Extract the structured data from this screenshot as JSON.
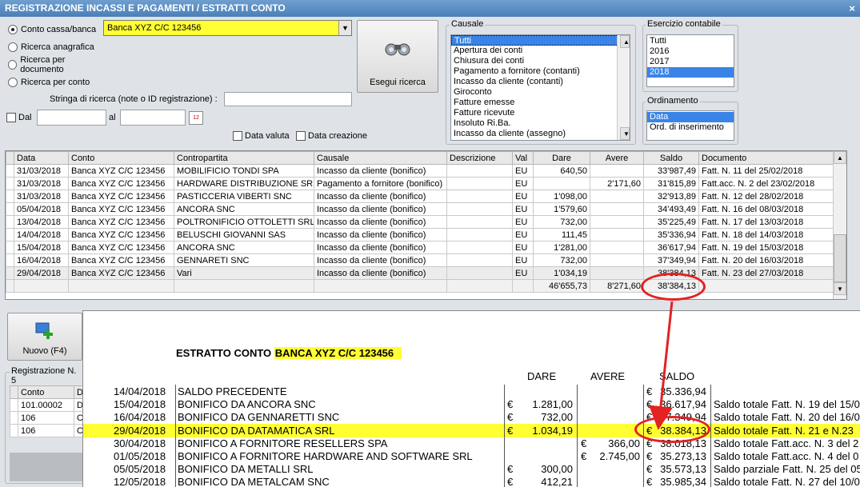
{
  "window": {
    "title": "REGISTRAZIONE INCASSI E PAGAMENTI / ESTRATTI CONTO",
    "close_glyph": "×"
  },
  "search": {
    "radios": [
      {
        "label": "Conto cassa/banca",
        "selected": true
      },
      {
        "label": "Ricerca anagrafica",
        "selected": false
      },
      {
        "label": "Ricerca per documento",
        "selected": false
      },
      {
        "label": "Ricerca per conto",
        "selected": false
      }
    ],
    "account_value": "Banca XYZ C/C 123456",
    "search_string_label": "Stringa di ricerca (note o ID registrazione) :",
    "search_string_value": "",
    "dal_label": "Dal",
    "al_label": "al",
    "dal_value": "",
    "al_value": "",
    "data_valuta_label": "Data valuta",
    "data_creazione_label": "Data creazione",
    "run_button": "Esegui ricerca",
    "calendar_icon_text": "12"
  },
  "causale": {
    "title": "Causale",
    "items": [
      "Tutti",
      "Apertura dei conti",
      "Chiusura dei conti",
      "Pagamento a fornitore (contanti)",
      "Incasso da cliente (contanti)",
      "Giroconto",
      "Fatture emesse",
      "Fatture ricevute",
      "Insoluto Ri.Ba.",
      "Incasso da cliente (assegno)"
    ],
    "selected": 0
  },
  "esercizio": {
    "title": "Esercizio contabile",
    "items": [
      "Tutti",
      "2016",
      "2017",
      "2018"
    ],
    "selected": 3
  },
  "ordinamento": {
    "title": "Ordinamento",
    "items": [
      "Data",
      "Ord. di inserimento"
    ],
    "selected": 0
  },
  "grid": {
    "headers": [
      "Data",
      "Conto",
      "Contropartita",
      "Causale",
      "Descrizione",
      "Val",
      "Dare",
      "Avere",
      "Saldo",
      "Documento"
    ],
    "rows": [
      [
        "31/03/2018",
        "Banca XYZ C/C 123456",
        "MOBILIFICIO TONDI SPA",
        "Incasso da cliente (bonifico)",
        "",
        "EU",
        "640,50",
        "",
        "33'987,49",
        "Fatt. N. 11 del 25/02/2018"
      ],
      [
        "31/03/2018",
        "Banca XYZ C/C 123456",
        "HARDWARE DISTRIBUZIONE SRL",
        "Pagamento a fornitore (bonifico)",
        "",
        "EU",
        "",
        "2'171,60",
        "31'815,89",
        "Fatt.acc. N. 2 del 23/02/2018"
      ],
      [
        "31/03/2018",
        "Banca XYZ C/C 123456",
        "PASTICCERIA VIBERTI SNC",
        "Incasso da cliente (bonifico)",
        "",
        "EU",
        "1'098,00",
        "",
        "32'913,89",
        "Fatt. N. 12 del 28/02/2018"
      ],
      [
        "05/04/2018",
        "Banca XYZ C/C 123456",
        "ANCORA SNC",
        "Incasso da cliente (bonifico)",
        "",
        "EU",
        "1'579,60",
        "",
        "34'493,49",
        "Fatt. N. 16 del 08/03/2018"
      ],
      [
        "13/04/2018",
        "Banca XYZ C/C 123456",
        "POLTRONIFICIO OTTOLETTI SRL",
        "Incasso da cliente (bonifico)",
        "",
        "EU",
        "732,00",
        "",
        "35'225,49",
        "Fatt. N. 17 del 13/03/2018"
      ],
      [
        "14/04/2018",
        "Banca XYZ C/C 123456",
        "BELUSCHI GIOVANNI SAS",
        "Incasso da cliente (bonifico)",
        "",
        "EU",
        "111,45",
        "",
        "35'336,94",
        "Fatt. N. 18 del 14/03/2018"
      ],
      [
        "15/04/2018",
        "Banca XYZ C/C 123456",
        "ANCORA SNC",
        "Incasso da cliente (bonifico)",
        "",
        "EU",
        "1'281,00",
        "",
        "36'617,94",
        "Fatt. N. 19 del 15/03/2018"
      ],
      [
        "16/04/2018",
        "Banca XYZ C/C 123456",
        "GENNARETI SNC",
        "Incasso da cliente (bonifico)",
        "",
        "EU",
        "732,00",
        "",
        "37'349,94",
        "Fatt. N. 20 del 16/03/2018"
      ],
      [
        "29/04/2018",
        "Banca XYZ C/C 123456",
        "Vari",
        "Incasso da cliente (bonifico)",
        "",
        "EU",
        "1'034,19",
        "",
        "38'384,13",
        "Fatt. N. 23 del 27/03/2018"
      ]
    ],
    "totals": {
      "dare": "46'655,73",
      "avere": "8'271,60",
      "saldo": "38'384,13"
    }
  },
  "lower": {
    "new_button": "Nuovo (F4)",
    "registrazione_label": "Registrazione N. 5",
    "sub_headers": [
      "Conto",
      "D"
    ],
    "sub_rows": [
      [
        "101.00002",
        "D"
      ],
      [
        "106",
        "C"
      ],
      [
        "106",
        "C"
      ]
    ]
  },
  "statement": {
    "title": "ESTRATTO CONTO",
    "account": "BANCA XYZ C/C 123456",
    "col_dare": "DARE",
    "col_avere": "AVERE",
    "col_saldo": "SALDO",
    "currency": "€",
    "rows": [
      {
        "date": "14/04/2018",
        "desc": "SALDO PRECEDENTE",
        "dare": "",
        "avere": "",
        "saldo": "35.336,94",
        "note": "",
        "highlight": false
      },
      {
        "date": "15/04/2018",
        "desc": "BONIFICO DA ANCORA SNC",
        "dare": "1.281,00",
        "avere": "",
        "saldo": "36.617,94",
        "note": "Saldo totale Fatt. N. 19 del 15/0",
        "highlight": false
      },
      {
        "date": "16/04/2018",
        "desc": "BONIFICO DA GENNARETTI SNC",
        "dare": "732,00",
        "avere": "",
        "saldo": "37.349,94",
        "note": "Saldo totale Fatt. N. 20 del 16/0",
        "highlight": false
      },
      {
        "date": "29/04/2018",
        "desc": "BONIFICO DA DATAMATICA SRL",
        "dare": "1.034,19",
        "avere": "",
        "saldo": "38.384,13",
        "note": "Saldo totale Fatt. N. 21 e N.23",
        "highlight": true
      },
      {
        "date": "30/04/2018",
        "desc": "BONIFICO A FORNITORE RESELLERS SPA",
        "dare": "",
        "avere": "366,00",
        "saldo": "38.018,13",
        "note": "Saldo totale Fatt.acc. N. 3 del 2",
        "highlight": false
      },
      {
        "date": "01/05/2018",
        "desc": "BONIFICO A FORNITORE HARDWARE AND SOFTWARE SRL",
        "dare": "",
        "avere": "2.745,00",
        "saldo": "35.273,13",
        "note": "Saldo totale Fatt.acc. N. 4 del 0",
        "highlight": false
      },
      {
        "date": "05/05/2018",
        "desc": "BONIFICO DA METALLI SRL",
        "dare": "300,00",
        "avere": "",
        "saldo": "35.573,13",
        "note": "Saldo parziale Fatt. N. 25 del 05",
        "highlight": false
      },
      {
        "date": "12/05/2018",
        "desc": "BONIFICO DA METALCAM SNC",
        "dare": "412,21",
        "avere": "",
        "saldo": "35.985,34",
        "note": "Saldo totale Fatt. N. 27 del 10/0",
        "highlight": false
      }
    ]
  },
  "colors": {
    "highlight": "#ffff33",
    "annotation": "#e32222",
    "selection": "#3a84e8"
  }
}
